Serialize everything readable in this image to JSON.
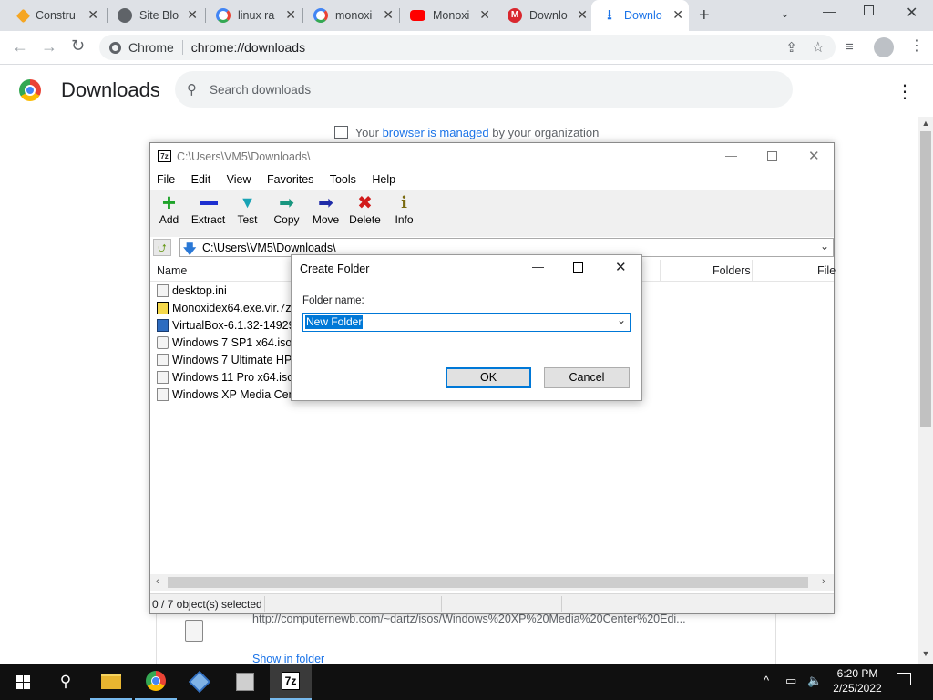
{
  "tabs": [
    {
      "label": "Constru",
      "icon": "diamond-icon",
      "color": "#f5a623"
    },
    {
      "label": "Site Blo",
      "icon": "globe-icon",
      "color": "#5f6368"
    },
    {
      "label": "linux ra",
      "icon": "google-icon",
      "color": "#4285f4"
    },
    {
      "label": "monoxi",
      "icon": "google-icon",
      "color": "#4285f4"
    },
    {
      "label": "Monoxi",
      "icon": "youtube-icon",
      "color": "#ff0000"
    },
    {
      "label": "Downlo",
      "icon": "mega-icon",
      "color": "#d9272e"
    },
    {
      "label": "Downlo",
      "icon": "download-icon",
      "color": "#1a73e8"
    }
  ],
  "omnibox": {
    "site": "Chrome",
    "url": "chrome://downloads"
  },
  "downloads": {
    "title": "Downloads",
    "search_placeholder": "Search downloads",
    "managed_pre": "Your ",
    "managed_link": "browser is managed",
    "managed_post": " by your organization",
    "bottom_url": "http://computernewb.com/~dartz/isos/Windows%20XP%20Media%20Center%20Edi...",
    "show_in_folder": "Show in folder"
  },
  "zip": {
    "title": "C:\\Users\\VM5\\Downloads\\",
    "logo": "7z",
    "menu": [
      "File",
      "Edit",
      "View",
      "Favorites",
      "Tools",
      "Help"
    ],
    "toolbar": [
      "Add",
      "Extract",
      "Test",
      "Copy",
      "Move",
      "Delete",
      "Info"
    ],
    "path": "C:\\Users\\VM5\\Downloads\\",
    "columns": {
      "name": "Name",
      "folders": "Folders",
      "files": "File"
    },
    "files": [
      "desktop.ini",
      "Monoxidex64.exe.vir.7z",
      "VirtualBox-6.1.32-14929...",
      "Windows 7 SP1 x64.iso",
      "Windows 7 Ultimate HP...",
      "Windows 11 Pro x64.iso",
      "Windows XP Media Cen..."
    ],
    "status": "0 / 7 object(s) selected"
  },
  "dialog": {
    "title": "Create Folder",
    "label": "Folder name:",
    "value": "New Folder",
    "ok": "OK",
    "cancel": "Cancel"
  },
  "taskbar": {
    "time": "6:20 PM",
    "date": "2/25/2022",
    "app7z": "7z"
  }
}
